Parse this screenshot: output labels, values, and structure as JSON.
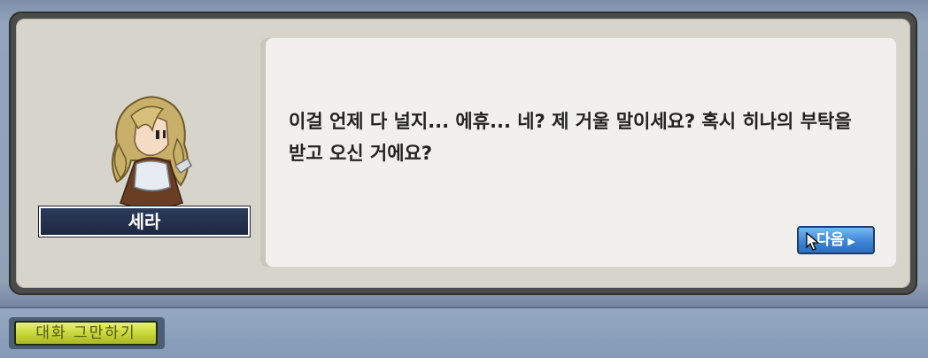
{
  "npc": {
    "name": "세라",
    "portrait_icon": "npc-portrait-blonde-woman"
  },
  "dialog": {
    "text": "이걸 언제 다 널지... 에휴... 네? 제 거울 말이세요? 혹시 히나의 부탁을 받고 오신 거에요?"
  },
  "buttons": {
    "next_label": "다음",
    "next_icon": "triangle-right-icon",
    "end_chat_label": "대화 그만하기"
  },
  "colors": {
    "next_button": "#3e86d6",
    "end_chat_button": "#c2d233",
    "name_plate": "#1d2841"
  }
}
